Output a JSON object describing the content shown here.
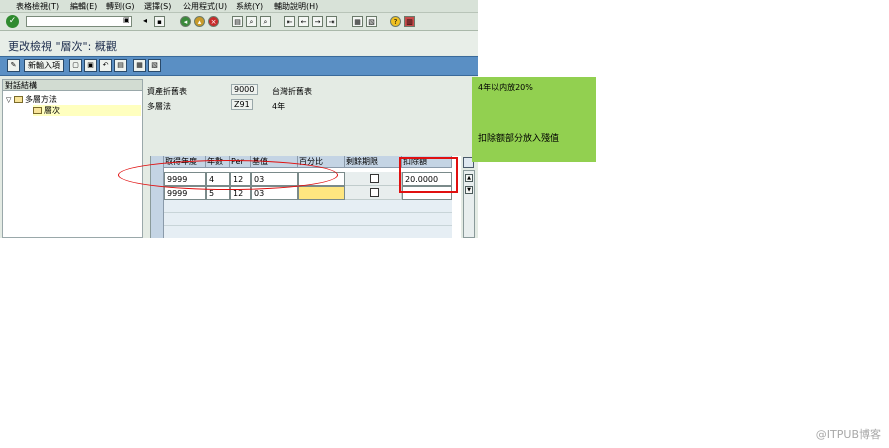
{
  "menu": [
    "表格檢視(T)",
    "編輯(E)",
    "轉到(G)",
    "選擇(S)",
    "公用程式(U)",
    "系統(Y)",
    "輔助說明(H)"
  ],
  "toolbar": {
    "command_value": "",
    "icons": [
      "enter-icon",
      "save-icon",
      "back-icon",
      "exit-icon",
      "cancel-icon",
      "print-icon",
      "find-icon",
      "find-next-icon",
      "first-page-icon",
      "prev-page-icon",
      "next-page-icon",
      "last-page-icon",
      "new-session-icon",
      "shortcut-icon",
      "help-icon",
      "layout-icon"
    ]
  },
  "title": "更改檢視 \"層次\": 概觀",
  "app_toolbar": {
    "new_entries_label": "新輸入項"
  },
  "tree": {
    "header": "對話結構",
    "nodes": [
      {
        "label": "多層方法",
        "expanded": true
      },
      {
        "label": "層次",
        "selected": true
      }
    ]
  },
  "header_fields": [
    {
      "label": "資產折舊表",
      "value": "9000",
      "description": "台灣折舊表"
    },
    {
      "label": "多層法",
      "value": "Z91",
      "description": "4年"
    }
  ],
  "table": {
    "columns": [
      "取得年度",
      "年數",
      "Per",
      "基值",
      "百分比",
      "剩餘期限",
      "扣除額"
    ],
    "rows": [
      {
        "year": "9999",
        "years": "4",
        "per": "12",
        "base": "03",
        "percent": "",
        "remaining": false,
        "deduction": "20.0000"
      },
      {
        "year": "9999",
        "years": "5",
        "per": "12",
        "base": "03",
        "percent": "",
        "remaining": false,
        "deduction": ""
      }
    ]
  },
  "note": {
    "line1": "4年以内放20%",
    "line2": "扣除额部分放入殘值"
  },
  "watermark": "@ITPUB博客"
}
